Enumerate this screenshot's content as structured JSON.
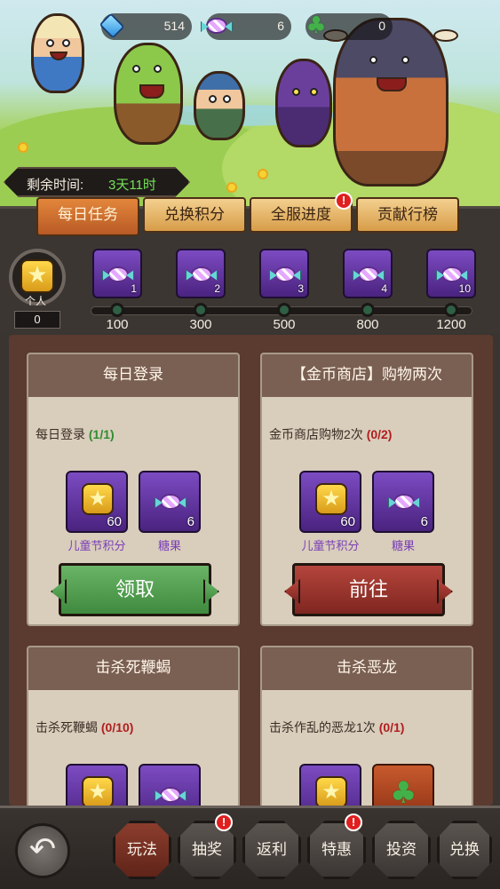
{
  "resources": {
    "gems": "514",
    "candies": "6",
    "clovers": "0"
  },
  "timer": {
    "label": "剩余时间:",
    "value": "3天11时"
  },
  "tabs": [
    {
      "label": "每日任务",
      "active": true
    },
    {
      "label": "兑换积分",
      "active": false
    },
    {
      "label": "全服进度",
      "active": false,
      "alert": "!"
    },
    {
      "label": "贡献行榜",
      "active": false
    }
  ],
  "progress": {
    "personal_label": "个人",
    "points": "0",
    "milestones": [
      {
        "threshold": "100",
        "reward_count": "1"
      },
      {
        "threshold": "300",
        "reward_count": "2"
      },
      {
        "threshold": "500",
        "reward_count": "3"
      },
      {
        "threshold": "800",
        "reward_count": "4"
      },
      {
        "threshold": "1200",
        "reward_count": "10"
      }
    ]
  },
  "tasks": [
    {
      "title": "每日登录",
      "desc": "每日登录",
      "progress": "(1/1)",
      "rewards": [
        {
          "icon": "star-icon",
          "count": "60",
          "label": "儿童节积分"
        },
        {
          "icon": "candy-icon",
          "count": "6",
          "label": "糖果"
        }
      ],
      "action": "领取",
      "action_color": "green"
    },
    {
      "title": "【金币商店】购物两次",
      "desc": "金币商店购物2次",
      "progress": "(0/2)",
      "rewards": [
        {
          "icon": "star-icon",
          "count": "60",
          "label": "儿童节积分"
        },
        {
          "icon": "candy-icon",
          "count": "6",
          "label": "糖果"
        }
      ],
      "action": "前往",
      "action_color": "red"
    },
    {
      "title": "击杀死鞭蝎",
      "desc": "击杀死鞭蝎",
      "progress": "(0/10)",
      "rewards": [
        {
          "icon": "star-icon"
        },
        {
          "icon": "candy-icon"
        }
      ]
    },
    {
      "title": "击杀恶龙",
      "desc": "击杀作乱的恶龙1次",
      "progress": "(0/1)",
      "rewards": [
        {
          "icon": "star-icon"
        },
        {
          "icon": "clover-icon"
        }
      ]
    }
  ],
  "bottom_nav": [
    {
      "label": "玩法",
      "active": true
    },
    {
      "label": "抽奖",
      "alert": "!"
    },
    {
      "label": "返利"
    },
    {
      "label": "特惠",
      "alert": "!"
    },
    {
      "label": "投资"
    },
    {
      "label": "兑换"
    }
  ],
  "colors": {
    "progress_done": "#2f8d2f",
    "progress_todo": "#b01e1e",
    "reward_label": "#7a3fb6",
    "claim_button": "#4f9c4d",
    "go_button": "#9a3530"
  }
}
